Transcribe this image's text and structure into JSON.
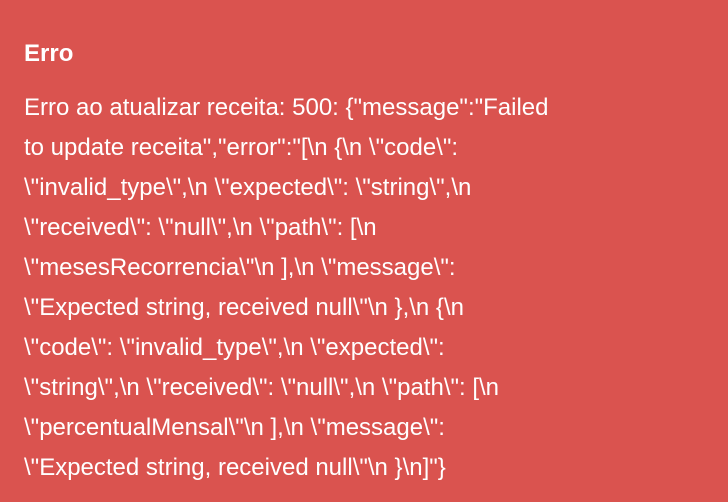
{
  "toast": {
    "variant": "error",
    "background_color": "#da534f",
    "text_color": "#ffffff",
    "title": "Erro",
    "message_lines": [
      "Erro ao atualizar receita: 500: {\"message\":\"Failed",
      "to update receita\",\"error\":\"[\\n {\\n \\\"code\\\":",
      "\\\"invalid_type\\\",\\n \\\"expected\\\": \\\"string\\\",\\n",
      "\\\"received\\\": \\\"null\\\",\\n \\\"path\\\": [\\n",
      "\\\"mesesRecorrencia\\\"\\n ],\\n \\\"message\\\":",
      "\\\"Expected string, received null\\\"\\n },\\n {\\n",
      "\\\"code\\\": \\\"invalid_type\\\",\\n \\\"expected\\\":",
      "\\\"string\\\",\\n \\\"received\\\": \\\"null\\\",\\n \\\"path\\\": [\\n",
      "\\\"percentualMensal\\\"\\n ],\\n \\\"message\\\":",
      "\\\"Expected string, received null\\\"\\n }\\n]\"}"
    ]
  }
}
